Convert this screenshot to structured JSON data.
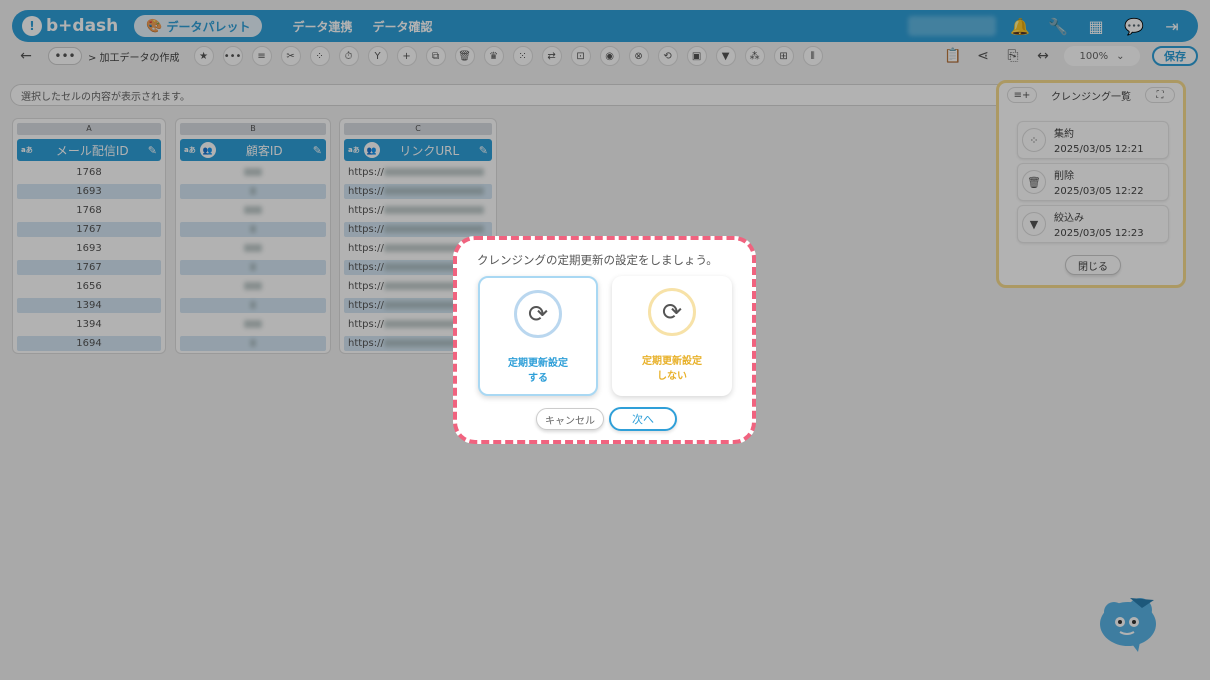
{
  "header": {
    "logo_text": "b+dash",
    "palette_label": "データパレット",
    "nav": [
      "データ連携",
      "データ確認"
    ],
    "icons": [
      "bell-icon",
      "wrench-icon",
      "grid-icon",
      "chat-icon",
      "logout-icon"
    ]
  },
  "toolbar": {
    "back_icon": "←",
    "dots_label": "•••",
    "breadcrumb": "> 加工データの作成",
    "tools": [
      "★",
      "•••",
      "≡",
      "✂",
      "⁘",
      "⏱",
      "Y",
      "+",
      "⧉",
      "🗑",
      "♛",
      "⁙",
      "⇄",
      "⊡",
      "◉",
      "⊗",
      "⟲",
      "▣",
      "▼",
      "⁂",
      "⊞",
      "⫴"
    ],
    "right_icons": [
      "📋",
      "⋖",
      "⎘",
      "↔"
    ],
    "zoom": "100%",
    "zoom_caret": "⌄",
    "save_label": "保存"
  },
  "cell_bar": {
    "placeholder": "選択したセルの内容が表示されます。"
  },
  "columns": [
    {
      "letter": "A",
      "prefix": "a̵あ",
      "tag": "",
      "name": "メール配信ID",
      "rows": [
        "1768",
        "1693",
        "1768",
        "1767",
        "1693",
        "1767",
        "1656",
        "1394",
        "1394",
        "1694"
      ]
    },
    {
      "letter": "B",
      "prefix": "a̵あ",
      "tag": "👥",
      "name": "顧客ID"
    },
    {
      "letter": "C",
      "prefix": "a̵あ",
      "tag": "👥",
      "name": "リンクURL",
      "url_prefix": "https://"
    }
  ],
  "side_panel": {
    "title": "クレンジング一覧",
    "items": [
      {
        "name": "集約",
        "time": "2025/03/05 12:21",
        "icon": "⁘"
      },
      {
        "name": "削除",
        "time": "2025/03/05 12:22",
        "icon": "🗑"
      },
      {
        "name": "絞込み",
        "time": "2025/03/05 12:23",
        "icon": "▼"
      }
    ],
    "close_label": "閉じる"
  },
  "modal": {
    "title": "クレンジングの定期更新の設定をしましょう。",
    "option_yes": {
      "line1": "定期更新設定",
      "line2": "する"
    },
    "option_no": {
      "line1": "定期更新設定",
      "line2": "しない"
    },
    "cancel_label": "キャンセル",
    "next_label": "次へ"
  },
  "colors": {
    "brand": "#2f9fd8",
    "accent_yellow": "#e8b12a",
    "modal_border": "#f0637f"
  }
}
